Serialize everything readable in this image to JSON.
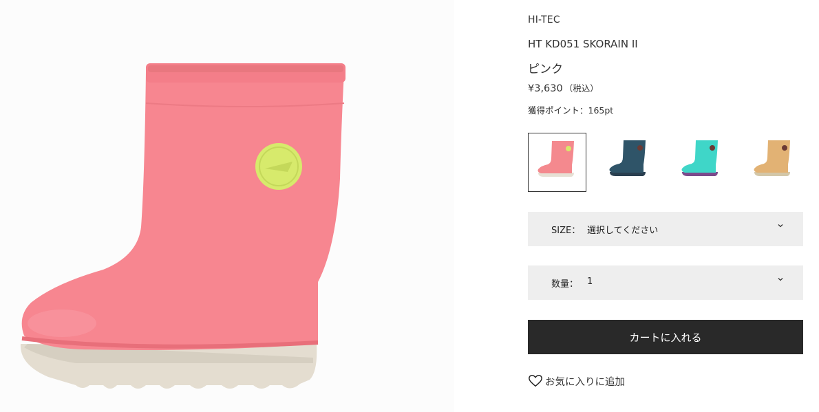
{
  "product": {
    "brand": "HI-TEC",
    "name": "HT KD051 SKORAIN II",
    "color": "ピンク",
    "price": "¥3,630",
    "tax_note": "（税込）",
    "points": "獲得ポイント：165pt"
  },
  "swatches": [
    {
      "name": "pink",
      "boot_color": "#f4898e",
      "sole_color": "#e6e0d4",
      "badge_color": "#d8e86a",
      "selected": true
    },
    {
      "name": "navy",
      "boot_color": "#2f5468",
      "sole_color": "#2a3f50",
      "badge_color": "#6b3a34",
      "selected": false
    },
    {
      "name": "mint",
      "boot_color": "#3fd6c8",
      "sole_color": "#7c4a8c",
      "badge_color": "#6b3a34",
      "selected": false
    },
    {
      "name": "beige",
      "boot_color": "#e2b274",
      "sole_color": "#d3c7a8",
      "badge_color": "#6b3a34",
      "selected": false
    }
  ],
  "size_select": {
    "label": "SIZE：",
    "value": "選択してください"
  },
  "qty_select": {
    "label": "数量：",
    "value": "1"
  },
  "cart_button": "カートに入れる",
  "favorite": "お気に入りに追加"
}
